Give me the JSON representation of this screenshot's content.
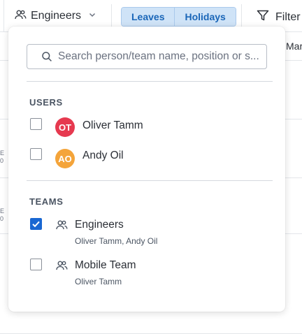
{
  "toolbar": {
    "team_filter_label": "Engineers",
    "team_filter_icon": "people-icon",
    "segments": [
      {
        "label": "Leaves",
        "active": true
      },
      {
        "label": "Holidays",
        "active": true
      }
    ],
    "filter_label": "Filter",
    "filter_icon": "funnel-icon"
  },
  "background": {
    "column_fragment": "Mar",
    "row_fragments": [
      "E\n0",
      "E\n0"
    ]
  },
  "dropdown": {
    "search": {
      "placeholder": "Search person/team name, position or s...",
      "value": ""
    },
    "users_title": "USERS",
    "users": [
      {
        "initials": "OT",
        "name": "Oliver Tamm",
        "avatar_color": "#e6394f",
        "checked": false
      },
      {
        "initials": "AO",
        "name": "Andy Oil",
        "avatar_color": "#f4a43a",
        "checked": false
      }
    ],
    "teams_title": "TEAMS",
    "teams": [
      {
        "name": "Engineers",
        "members": "Oliver Tamm, Andy Oil",
        "checked": true
      },
      {
        "name": "Mobile Team",
        "members": "Oliver Tamm",
        "checked": false
      }
    ]
  },
  "colors": {
    "accent": "#1967d2",
    "segment_bg": "#cfe3f7",
    "segment_text": "#1a66b8"
  }
}
